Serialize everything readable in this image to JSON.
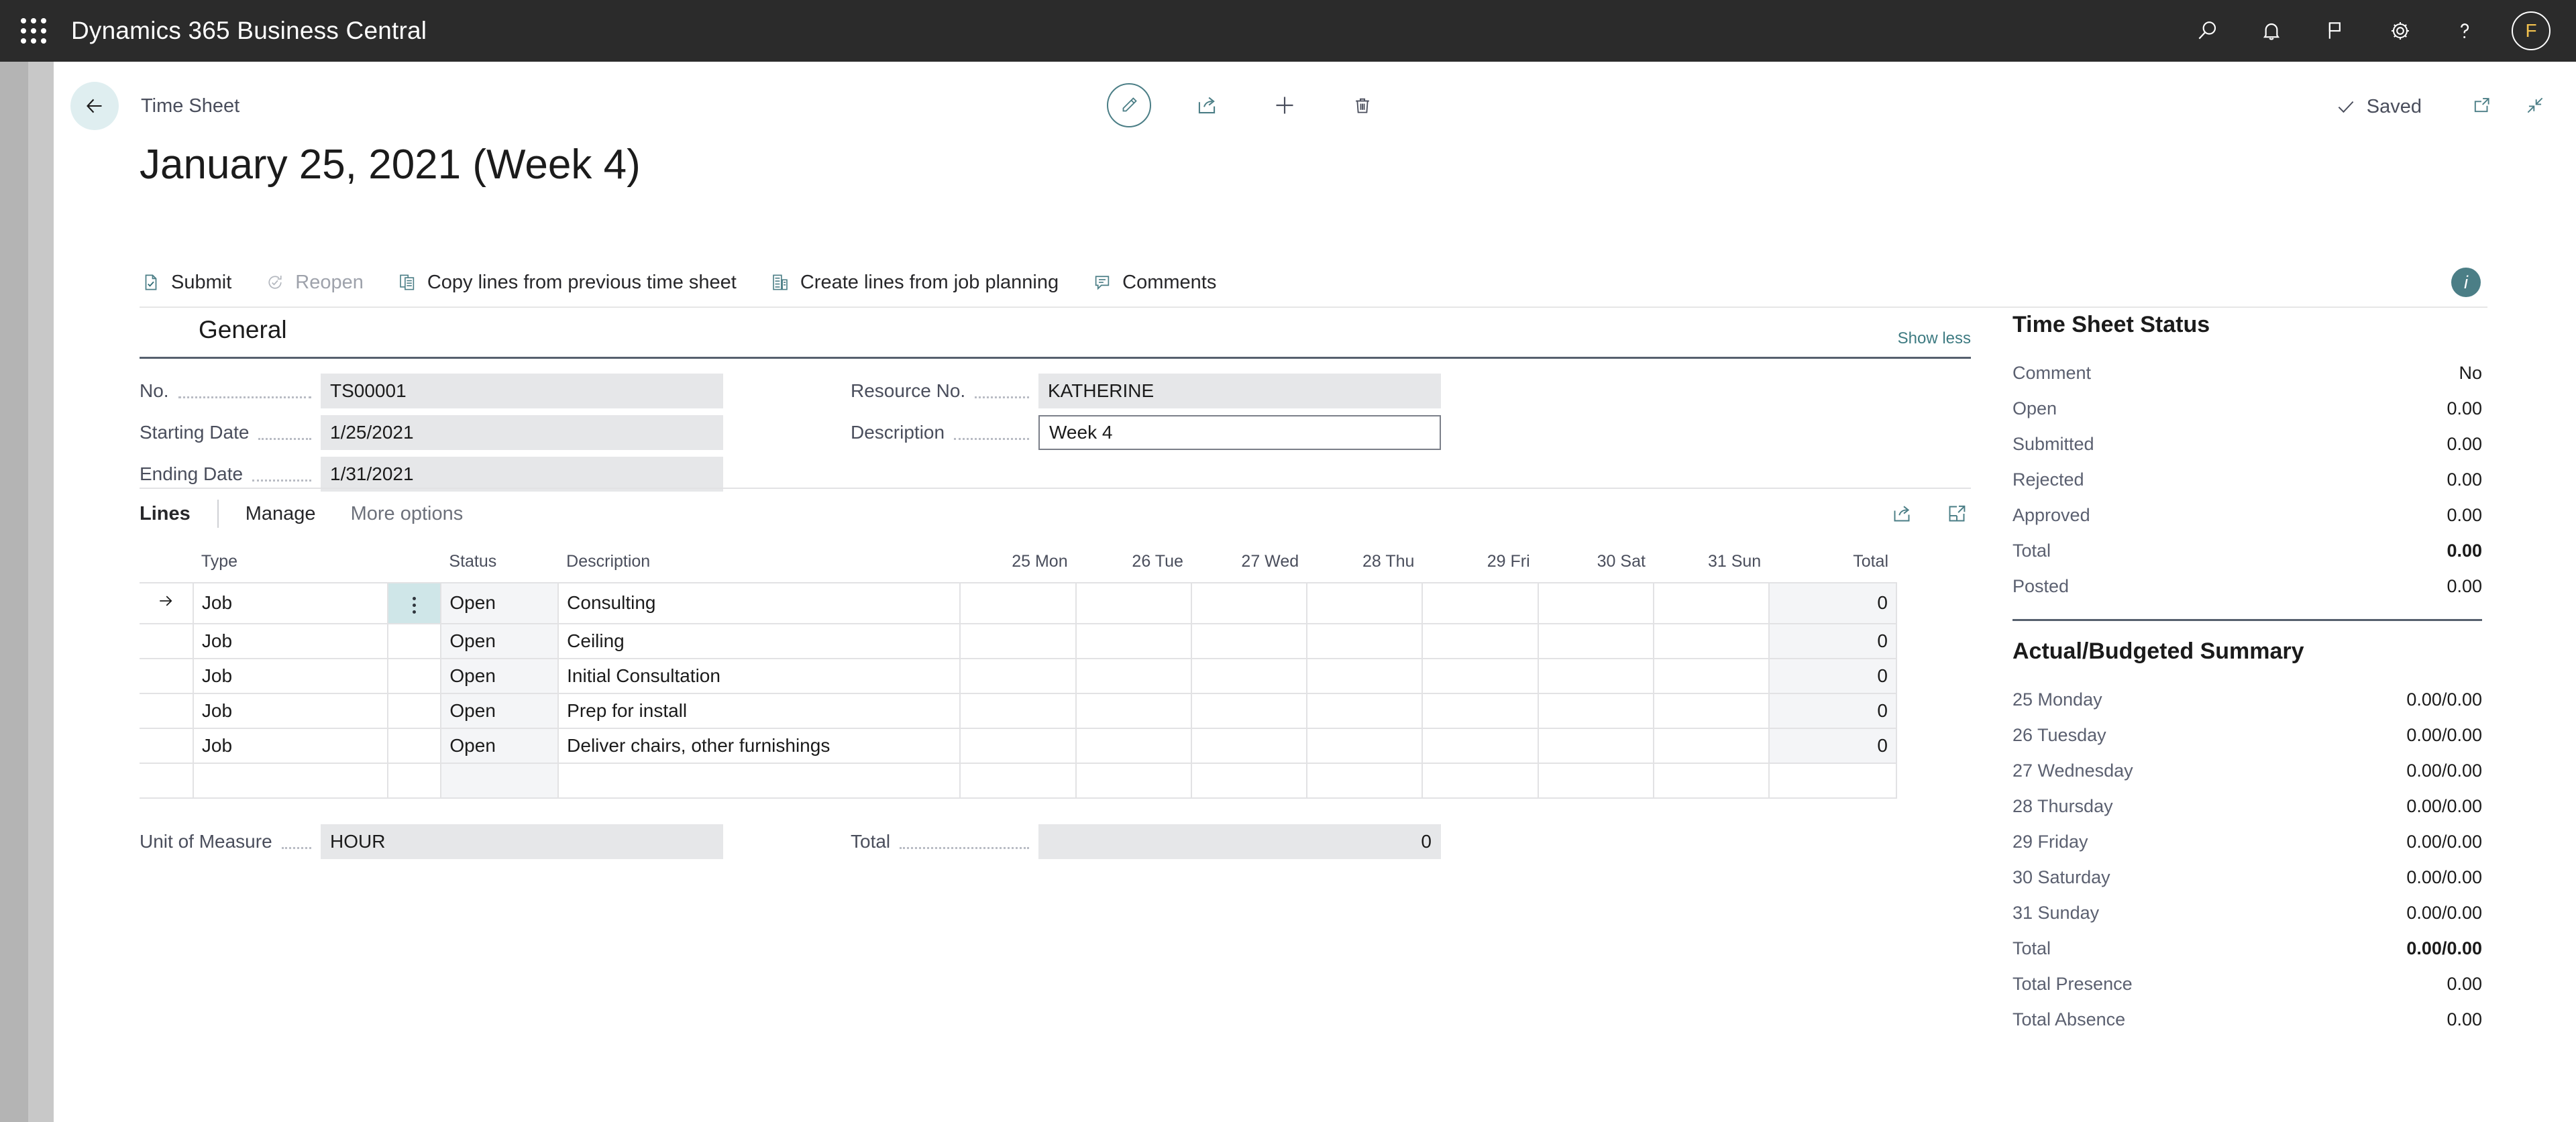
{
  "topbar": {
    "app_title": "Dynamics 365 Business Central",
    "waffle_name": "app-launcher",
    "icons": [
      "search-icon",
      "bell-icon",
      "flag-icon",
      "gear-icon",
      "help-icon"
    ],
    "avatar_initial": "F"
  },
  "header": {
    "breadcrumb": "Time Sheet",
    "doc_title": "January 25, 2021 (Week 4)",
    "saved_label": "Saved",
    "center_actions": [
      "edit-pencil-icon",
      "share-icon",
      "new-plus-icon",
      "delete-trash-icon"
    ],
    "right_icons": [
      "open-in-new-window-icon",
      "collapse-icon"
    ]
  },
  "action_bar": {
    "items": [
      {
        "label": "Submit",
        "icon": "submit-icon",
        "disabled": false
      },
      {
        "label": "Reopen",
        "icon": "reopen-icon",
        "disabled": true
      },
      {
        "label": "Copy lines from previous time sheet",
        "icon": "copy-lines-icon",
        "disabled": false
      },
      {
        "label": "Create lines from job planning",
        "icon": "create-lines-icon",
        "disabled": false
      },
      {
        "label": "Comments",
        "icon": "comments-icon",
        "disabled": false
      }
    ],
    "info_badge": "i"
  },
  "general": {
    "title": "General",
    "show_less": "Show less",
    "fields": [
      {
        "label": "No.",
        "value": "TS00001",
        "editable": false
      },
      {
        "label": "Starting Date",
        "value": "1/25/2021",
        "editable": false
      },
      {
        "label": "Ending Date",
        "value": "1/31/2021",
        "editable": false
      },
      {
        "label": "Resource No.",
        "value": "KATHERINE",
        "editable": false
      },
      {
        "label": "Description",
        "value": "Week 4",
        "editable": true
      }
    ]
  },
  "lines": {
    "tabs": [
      {
        "label": "Lines",
        "active": true
      },
      {
        "label": "Manage",
        "active": false
      },
      {
        "label": "More options",
        "active": false
      }
    ],
    "tab_icons": [
      "share-icon",
      "open-in-excel-icon"
    ],
    "columns": [
      "Type",
      "",
      "Status",
      "Description",
      "25 Mon",
      "26 Tue",
      "27 Wed",
      "28 Thu",
      "29 Fri",
      "30 Sat",
      "31 Sun",
      "Total"
    ],
    "rows": [
      {
        "selected": true,
        "type": "Job",
        "status": "Open",
        "description": "Consulting",
        "days": [
          "",
          "",
          "",
          "",
          "",
          "",
          ""
        ],
        "total": "0"
      },
      {
        "selected": false,
        "type": "Job",
        "status": "Open",
        "description": "Ceiling",
        "days": [
          "",
          "",
          "",
          "",
          "",
          "",
          ""
        ],
        "total": "0"
      },
      {
        "selected": false,
        "type": "Job",
        "status": "Open",
        "description": "Initial Consultation",
        "days": [
          "",
          "",
          "",
          "",
          "",
          "",
          ""
        ],
        "total": "0"
      },
      {
        "selected": false,
        "type": "Job",
        "status": "Open",
        "description": "Prep for install",
        "days": [
          "",
          "",
          "",
          "",
          "",
          "",
          ""
        ],
        "total": "0"
      },
      {
        "selected": false,
        "type": "Job",
        "status": "Open",
        "description": "Deliver chairs, other furnishings",
        "days": [
          "",
          "",
          "",
          "",
          "",
          "",
          ""
        ],
        "total": "0"
      },
      {
        "selected": false,
        "type": "",
        "status": "",
        "description": "",
        "days": [
          "",
          "",
          "",
          "",
          "",
          "",
          ""
        ],
        "total": "",
        "empty": true
      }
    ],
    "footer": [
      {
        "label": "Unit of Measure",
        "value": "HOUR",
        "align": "left"
      },
      {
        "label": "Total",
        "value": "0",
        "align": "right"
      }
    ]
  },
  "side": {
    "status_panel": {
      "title": "Time Sheet Status",
      "rows": [
        {
          "key": "Comment",
          "value": "No",
          "bold": false
        },
        {
          "key": "Open",
          "value": "0.00",
          "bold": false
        },
        {
          "key": "Submitted",
          "value": "0.00",
          "bold": false
        },
        {
          "key": "Rejected",
          "value": "0.00",
          "bold": false
        },
        {
          "key": "Approved",
          "value": "0.00",
          "bold": false
        },
        {
          "key": "Total",
          "value": "0.00",
          "bold": true
        },
        {
          "key": "Posted",
          "value": "0.00",
          "bold": false
        }
      ]
    },
    "summary_panel": {
      "title": "Actual/Budgeted Summary",
      "rows": [
        {
          "key": "25 Monday",
          "value": "0.00/0.00",
          "bold": false
        },
        {
          "key": "26 Tuesday",
          "value": "0.00/0.00",
          "bold": false
        },
        {
          "key": "27 Wednesday",
          "value": "0.00/0.00",
          "bold": false
        },
        {
          "key": "28 Thursday",
          "value": "0.00/0.00",
          "bold": false
        },
        {
          "key": "29 Friday",
          "value": "0.00/0.00",
          "bold": false
        },
        {
          "key": "30 Saturday",
          "value": "0.00/0.00",
          "bold": false
        },
        {
          "key": "31 Sunday",
          "value": "0.00/0.00",
          "bold": false
        },
        {
          "key": "Total",
          "value": "0.00/0.00",
          "bold": true
        },
        {
          "key": "Total Presence",
          "value": "0.00",
          "bold": false
        },
        {
          "key": "Total Absence",
          "value": "0.00",
          "bold": false
        }
      ]
    }
  },
  "colors": {
    "nav_bg": "#2b2b2b",
    "accent_teal": "#4b7e86",
    "selection_teal": "#cfe6e8",
    "field_gray": "#e6e7e9",
    "rule_dark": "#56606e"
  }
}
